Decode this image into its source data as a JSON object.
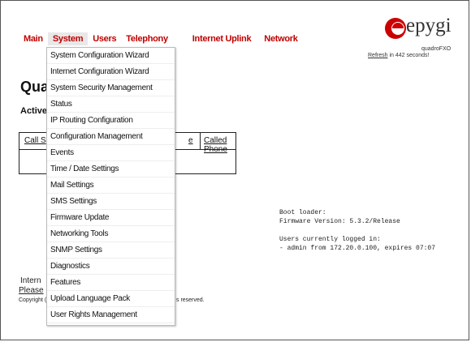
{
  "topnav": {
    "items": [
      {
        "label": "Main"
      },
      {
        "label": "System"
      },
      {
        "label": "Users"
      },
      {
        "label": "Telephony"
      },
      {
        "label": "Internet Uplink"
      },
      {
        "label": "Network"
      }
    ]
  },
  "logo": {
    "brand": "epygi",
    "product": "quadroFXO",
    "refresh_link": "Refresh",
    "refresh_rest": " in 442 seconds!"
  },
  "main": {
    "page_title": "Quad",
    "sub_title": "Active",
    "table_headers": [
      "Call S",
      "e",
      "Called Phone"
    ],
    "boot_lines": "Boot loader:\nFirmware Version: 5.3.2/Release\n\nUsers currently logged in:\n- admin from 172.20.0.100, expires 07:07",
    "footer_a": "Intern",
    "footer_b": "Please",
    "footer_c": "Copyright (C)",
    "footer_d": "s reserved."
  },
  "dropdown": {
    "items": [
      "System Configuration Wizard",
      "Internet Configuration Wizard",
      "System Security Management",
      "Status",
      "IP Routing Configuration",
      "Configuration Management",
      "Events",
      "Time / Date Settings",
      "Mail Settings",
      "SMS Settings",
      "Firmware Update",
      "Networking Tools",
      "SNMP Settings",
      "Diagnostics",
      "Features",
      "Upload Language Pack",
      "User Rights Management"
    ]
  },
  "colors": {
    "nav_red": "#c00000",
    "logo_red": "#cc0000"
  }
}
